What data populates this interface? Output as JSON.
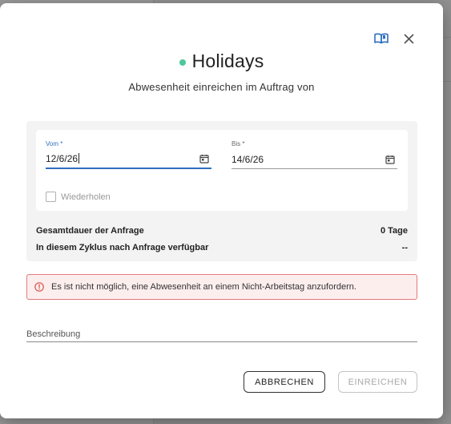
{
  "modal": {
    "title": "Holidays",
    "subtitle": "Abwesenheit einreichen im Auftrag von",
    "status_color": "#4dc89a",
    "icons": [
      "book-open-icon",
      "close-icon"
    ]
  },
  "form": {
    "from": {
      "label": "Vom *",
      "value": "12/6/26"
    },
    "to": {
      "label": "Bis *",
      "value": "14/6/26"
    },
    "repeat_label": "Wiederholen",
    "repeat_checked": false
  },
  "summary": [
    {
      "label": "Gesamtdauer der Anfrage",
      "value": "0 Tage"
    },
    {
      "label": "In diesem Zyklus nach Anfrage verfügbar",
      "value": "--"
    }
  ],
  "alert": {
    "text": "Es ist nicht möglich, eine Abwesenheit an einem Nicht-Arbeitstag anzufordern.",
    "color": "#e07b7b"
  },
  "description": {
    "label": "Beschreibung"
  },
  "buttons": {
    "cancel": "ABBRECHEN",
    "submit": "EINREICHEN"
  },
  "colors": {
    "accent": "#2f6fbf",
    "success": "#4dc89a",
    "error": "#d9534f"
  }
}
